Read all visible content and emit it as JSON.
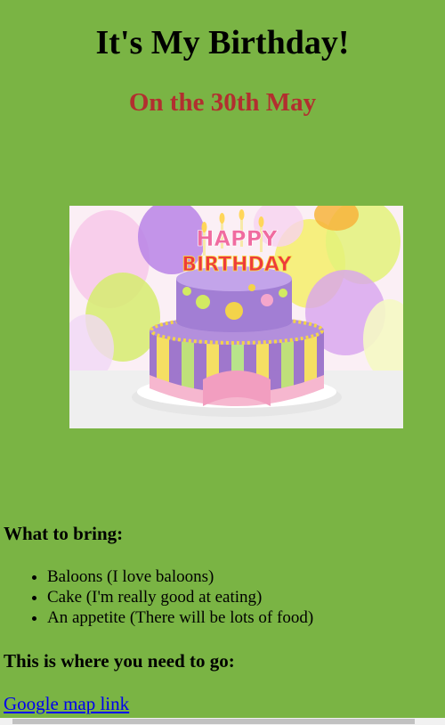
{
  "page": {
    "title": "It's My Birthday!",
    "subtitle": "On the 30th May"
  },
  "image": {
    "alt": "Birthday cake",
    "cake_text_top": "HAPPY",
    "cake_text_bottom": "BIRTHDAY"
  },
  "bring": {
    "heading": "What to bring:",
    "items": [
      "Baloons (I love baloons)",
      "Cake (I'm really good at eating)",
      "An appetite (There will be lots of food)"
    ]
  },
  "where": {
    "heading": "This is where you need to go:",
    "link_label": "Google map link"
  },
  "colors": {
    "background": "#7ab444",
    "subtitle": "#b22f2f",
    "link": "#0000ee"
  }
}
